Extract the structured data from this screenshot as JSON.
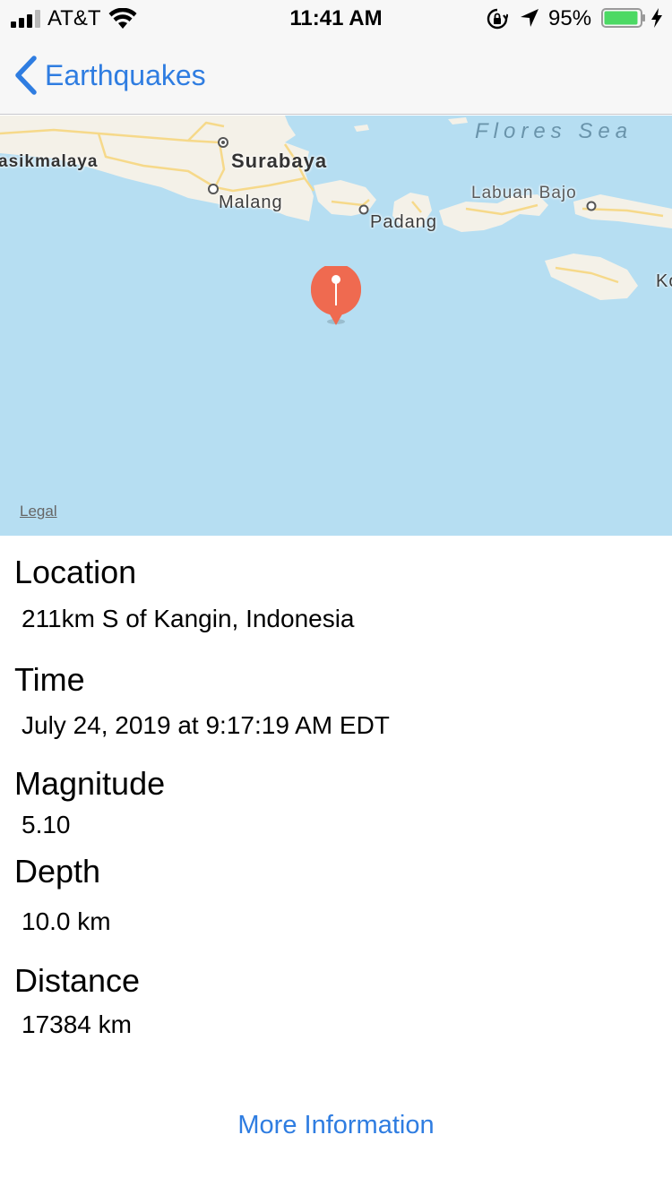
{
  "status_bar": {
    "carrier": "AT&T",
    "time": "11:41 AM",
    "battery_percent": "95%",
    "battery_level": 0.95,
    "icons": [
      "signal-icon",
      "wifi-icon",
      "orientation-lock-icon",
      "location-arrow-icon",
      "battery-icon",
      "charging-icon"
    ]
  },
  "nav": {
    "back_label": "Earthquakes"
  },
  "map": {
    "labels": {
      "sea": "Flores Sea",
      "tasikmalaya": "asikmalaya",
      "surabaya": "Surabaya",
      "malang": "Malang",
      "padang": "Padang",
      "labuan_bajo": "Labuan Bajo",
      "ko": "Ko"
    },
    "legal": "Legal",
    "colors": {
      "water": "#b6def2",
      "land": "#f4f1e8",
      "road": "#f6d98a",
      "pin": "#ef6a50"
    }
  },
  "details": {
    "location": {
      "heading": "Location",
      "value": "211km S of Kangin, Indonesia"
    },
    "time": {
      "heading": "Time",
      "value": "July 24, 2019 at 9:17:19 AM EDT"
    },
    "magnitude": {
      "heading": "Magnitude",
      "value": "5.10"
    },
    "depth": {
      "heading": "Depth",
      "value": "10.0 km"
    },
    "distance": {
      "heading": "Distance",
      "value": "17384 km"
    }
  },
  "more_info_label": "More Information",
  "accent_color": "#2f7de1"
}
